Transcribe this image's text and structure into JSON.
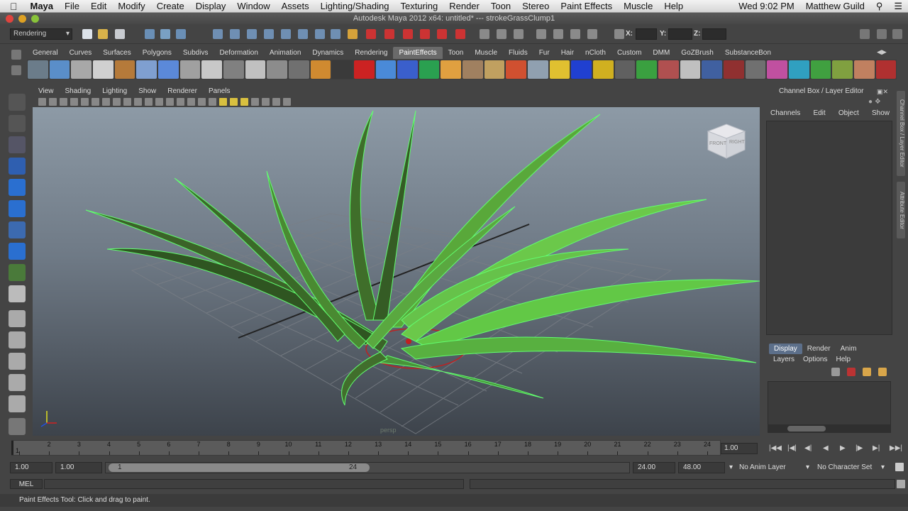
{
  "menubar": {
    "app": "Maya",
    "items": [
      "File",
      "Edit",
      "Modify",
      "Create",
      "Display",
      "Window",
      "Assets",
      "Lighting/Shading",
      "Texturing",
      "Render",
      "Toon",
      "Stereo",
      "Paint Effects",
      "Muscle",
      "Help"
    ],
    "clock": "Wed 9:02 PM",
    "user": "Matthew Guild"
  },
  "window": {
    "title": "Autodesk Maya 2012 x64: untitled*   ---   strokeGrassClump1"
  },
  "statusline": {
    "menuset": "Rendering",
    "x_label": "X:",
    "y_label": "Y:",
    "z_label": "Z:"
  },
  "shelf": {
    "tabs": [
      "General",
      "Curves",
      "Surfaces",
      "Polygons",
      "Subdivs",
      "Deformation",
      "Animation",
      "Dynamics",
      "Rendering",
      "PaintEffects",
      "Toon",
      "Muscle",
      "Fluids",
      "Fur",
      "Hair",
      "nCloth",
      "Custom",
      "DMM",
      "GoZBrush",
      "SubstanceBon"
    ],
    "active_tab": "PaintEffects",
    "button_colors": [
      "#6b7c8a",
      "#5a8ec9",
      "#a8a8a8",
      "#d0d0d0",
      "#b57a3a",
      "#7f9fd0",
      "#5b89d9",
      "#a0a0a0",
      "#c8c8c8",
      "#808080",
      "#c0c0c0",
      "#8c8c8c",
      "#707070",
      "#d08a30",
      "#3a3a3a",
      "#cc2222",
      "#4a8ad8",
      "#3a5fcc",
      "#2aa050",
      "#e0a040",
      "#a08060",
      "#c0a060",
      "#d05030",
      "#90a0b0",
      "#e0c030",
      "#2040d0",
      "#d0b020",
      "#606060",
      "#3aa040",
      "#b05050",
      "#c0c0c0",
      "#4060a0",
      "#903030",
      "#707070",
      "#c050a0",
      "#30a0c0",
      "#40a040",
      "#80a040",
      "#c08060",
      "#b03030"
    ]
  },
  "panel": {
    "menus": [
      "View",
      "Shading",
      "Lighting",
      "Show",
      "Renderer",
      "Panels"
    ],
    "viewcube": {
      "front": "FRONT",
      "right": "RIGHT"
    },
    "camera_label": "persp"
  },
  "channelbox": {
    "title": "Channel Box / Layer Editor",
    "menus": [
      "Channels",
      "Edit",
      "Object",
      "Show"
    ],
    "side_tabs": [
      "Channel Box / Layer Editor",
      "Attribute Editor"
    ]
  },
  "layers": {
    "tabs": [
      "Display",
      "Render",
      "Anim"
    ],
    "active_tab": "Display",
    "menus": [
      "Layers",
      "Options",
      "Help"
    ]
  },
  "timeline": {
    "frames": [
      "1",
      "2",
      "3",
      "4",
      "5",
      "6",
      "7",
      "8",
      "9",
      "10",
      "11",
      "12",
      "13",
      "14",
      "15",
      "16",
      "17",
      "18",
      "19",
      "20",
      "21",
      "22",
      "23",
      "24"
    ],
    "current_frame": "1.00",
    "current_frame_marker": "1"
  },
  "range": {
    "start_frame": "1.00",
    "playback_start": "1.00",
    "slider_start": "1",
    "slider_end": "24",
    "playback_end": "24.00",
    "end_frame": "48.00",
    "anim_layer": "No Anim Layer",
    "character_set": "No Character Set"
  },
  "commandline": {
    "lang": "MEL"
  },
  "helpline": {
    "text": "Paint Effects Tool: Click and drag to paint."
  }
}
